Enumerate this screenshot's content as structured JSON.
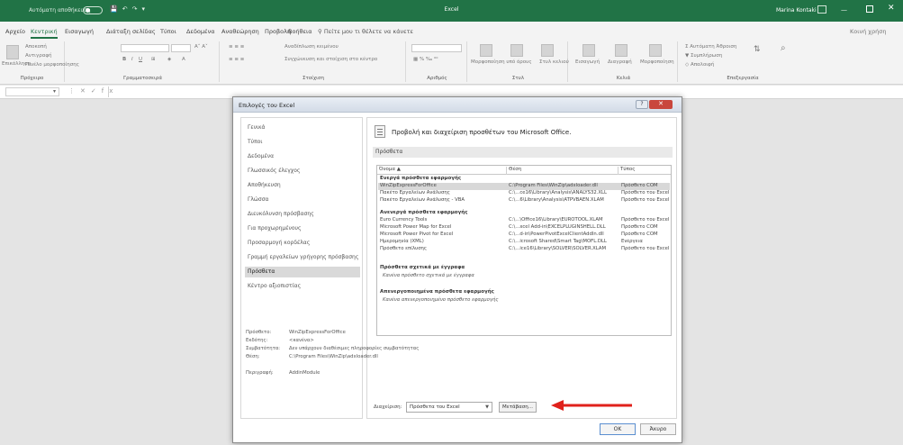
{
  "titlebar": {
    "autosave": "Αυτόματη αποθήκευση",
    "app_title": "Excel",
    "user": "Marina Kontaki"
  },
  "tabs": [
    "Αρχείο",
    "Κεντρική",
    "Εισαγωγή",
    "Διάταξη σελίδας",
    "Τύποι",
    "Δεδομένα",
    "Αναθεώρηση",
    "Προβολή",
    "Βοήθεια"
  ],
  "tell_me": "Πείτε μου τι θέλετε να κάνετε",
  "share": "Κοινή χρήση",
  "ribbon": {
    "clipboard": {
      "paste": "Επικόλληση",
      "cut": "Αποκοπή",
      "copy": "Αντιγραφή",
      "painter": "Πινέλο μορφοποίησης",
      "label": "Πρόχειρο"
    },
    "font_label": "Γραμματοσειρά",
    "alignment": {
      "wrap": "Αναδίπλωση κειμένου",
      "merge": "Συγχώνευση και στοίχιση στο κέντρο",
      "label": "Στοίχιση"
    },
    "number_label": "Αριθμός",
    "styles": {
      "cond": "Μορφοποίηση υπό όρους",
      "table": "Μορφοποίηση ως πίνακα",
      "cell": "Στυλ κελιού",
      "label": "Στυλ"
    },
    "cells": {
      "insert": "Εισαγωγή",
      "delete": "Διαγραφή",
      "format": "Μορφοποίηση",
      "label": "Κελιά"
    },
    "editing": {
      "autosum": "Αυτόματη Άθροιση",
      "fill": "Συμπλήρωση",
      "clear": "Απαλοιφή",
      "sort": "Ταξινόμηση και φιλτράρισμα",
      "find": "Εύρεση και επιλογή",
      "label": "Επεξεργασία"
    }
  },
  "dialog": {
    "title": "Επιλογές του Excel",
    "help": "?",
    "close": "✕",
    "nav": [
      {
        "label": "Γενικά",
        "selected": false
      },
      {
        "label": "Τύποι",
        "selected": false
      },
      {
        "label": "Δεδομένα",
        "selected": false
      },
      {
        "label": "Γλωσσικός έλεγχος",
        "selected": false
      },
      {
        "label": "Αποθήκευση",
        "selected": false
      },
      {
        "label": "Γλώσσα",
        "selected": false
      },
      {
        "label": "Διευκόλυνση πρόσβασης",
        "selected": false
      },
      {
        "label": "Για προχωρημένους",
        "selected": false
      },
      {
        "label": "Προσαρμογή κορδέλας",
        "selected": false
      },
      {
        "label": "Γραμμή εργαλείων γρήγορης πρόσβασης",
        "selected": false
      },
      {
        "label": "Πρόσθετα",
        "selected": true
      },
      {
        "label": "Κέντρο αξιοπιστίας",
        "selected": false
      }
    ],
    "heading": "Προβολή και διαχείριση προσθέτων του Microsoft Office.",
    "section": "Πρόσθετα",
    "columns": [
      "Όνομα ▲",
      "Θέση",
      "Τύπος"
    ],
    "groups": {
      "active": "Ενεργά πρόσθετα εφαρμογής",
      "inactive": "Ανενεργά πρόσθετα εφαρμογής",
      "document": "Πρόσθετα σχετικά με έγγραφα",
      "document_none": "Κανένα πρόσθετο σχετικά με έγγραφα",
      "disabled": "Απενεργοποιημένα πρόσθετα εφαρμογής",
      "disabled_none": "Κανένα απενεργοποιημένο πρόσθετο εφαρμογής"
    },
    "active_rows": [
      {
        "name": "WinZipExpressForOffice",
        "location": "C:\\Program Files\\WinZip\\adxloader.dll",
        "type": "Πρόσθετο COM"
      },
      {
        "name": "Πακέτο Εργαλείων Ανάλυσης",
        "location": "C:\\...ce16\\Library\\Analysis\\ANALYS32.XLL",
        "type": "Πρόσθετο του Excel"
      },
      {
        "name": "Πακέτο Εργαλείων Ανάλυσης - VBA",
        "location": "C:\\...6\\Library\\Analysis\\ATPVBAEN.XLAM",
        "type": "Πρόσθετο του Excel"
      }
    ],
    "inactive_rows": [
      {
        "name": "Euro Currency Tools",
        "location": "C:\\...\\Office16\\Library\\EUROTOOL.XLAM",
        "type": "Πρόσθετο του Excel"
      },
      {
        "name": "Microsoft Power Map for Excel",
        "location": "C:\\...xcel Add-in\\EXCELPLUGINSHELL.DLL",
        "type": "Πρόσθετο COM"
      },
      {
        "name": "Microsoft Power Pivot for Excel",
        "location": "C:\\...d-in\\PowerPivotExcelClientAddIn.dll",
        "type": "Πρόσθετο COM"
      },
      {
        "name": "Ημερομηνία (XML)",
        "location": "C:\\...icrosoft Shared\\Smart Tag\\MOFL.DLL",
        "type": "Ενέργεια"
      },
      {
        "name": "Πρόσθετο επίλυσης",
        "location": "C:\\...ice16\\Library\\SOLVER\\SOLVER.XLAM",
        "type": "Πρόσθετο του Excel"
      }
    ],
    "details": [
      {
        "label": "Πρόσθετο:",
        "value": "WinZipExpressForOffice"
      },
      {
        "label": "Εκδότης:",
        "value": "<κανένα>"
      },
      {
        "label": "Συμβατότητα:",
        "value": "Δεν υπάρχουν διαθέσιμες πληροφορίες συμβατότητας"
      },
      {
        "label": "Θέση:",
        "value": "C:\\Program Files\\WinZip\\adxloader.dll"
      },
      {
        "label": "Περιγραφή:",
        "value": "AddinModule"
      }
    ],
    "manage_label": "Διαχείριση:",
    "manage_value": "Πρόσθετα του Excel",
    "go_button": "Μετάβαση...",
    "ok": "OK",
    "cancel": "Άκυρο"
  },
  "colors": {
    "excel_green": "#217346",
    "arrow_red": "#e0211b",
    "close_red": "#c9463d"
  }
}
